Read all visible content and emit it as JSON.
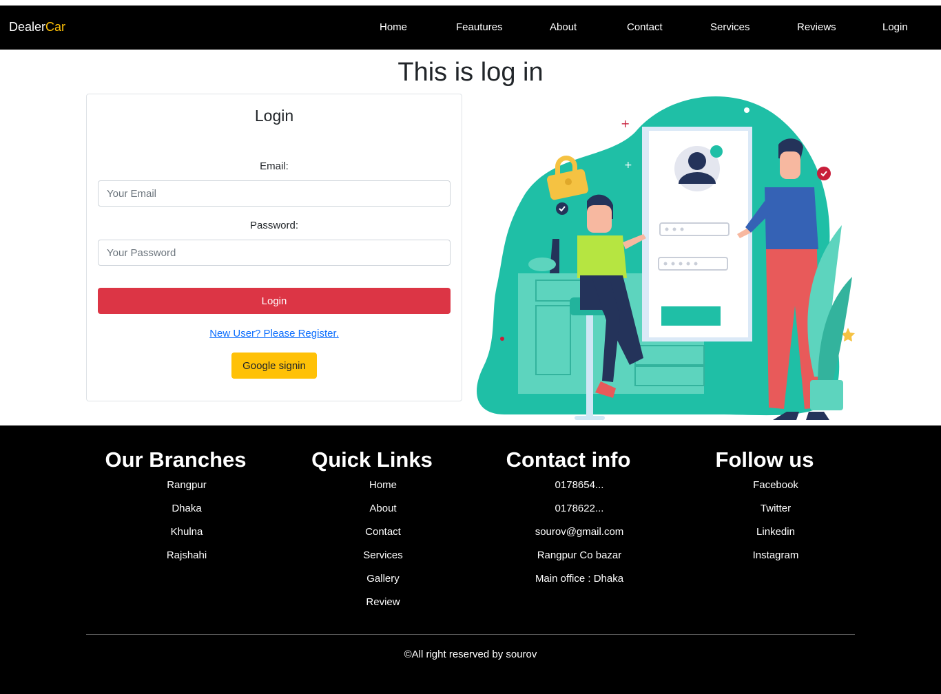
{
  "navbar": {
    "brand_main": "Dealer",
    "brand_accent": "Car",
    "links": [
      "Home",
      "Feautures",
      "About",
      "Contact",
      "Services",
      "Reviews",
      "Login"
    ]
  },
  "page": {
    "heading": "This is log in"
  },
  "login_form": {
    "title": "Login",
    "email_label": "Email:",
    "email_placeholder": "Your Email",
    "password_label": "Password:",
    "password_placeholder": "Your Password",
    "submit_label": "Login",
    "register_link": "New User? Please Register.",
    "google_label": "Google signin"
  },
  "footer": {
    "branches": {
      "title": "Our Branches",
      "items": [
        "Rangpur",
        "Dhaka",
        "Khulna",
        "Rajshahi"
      ]
    },
    "quick_links": {
      "title": "Quick Links",
      "items": [
        "Home",
        "About",
        "Contact",
        "Services",
        "Gallery",
        "Review"
      ]
    },
    "contact": {
      "title": "Contact info",
      "items": [
        "0178654...",
        "0178622...",
        "sourov@gmail.com",
        "Rangpur Co bazar",
        "Main office : Dhaka"
      ]
    },
    "follow": {
      "title": "Follow us",
      "items": [
        "Facebook",
        "Twitter",
        "Linkedin",
        "Instagram"
      ]
    },
    "copyright": "©All right reserved by sourov"
  },
  "colors": {
    "navbar_bg": "#000000",
    "accent": "#ffc107",
    "login_button": "#dc3545",
    "illustration_teal": "#1fbfa6"
  }
}
